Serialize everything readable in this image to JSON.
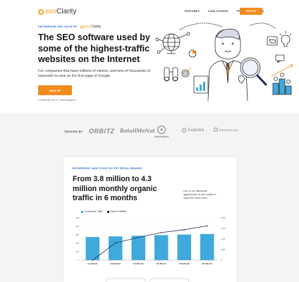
{
  "nav": {
    "logo_prefix": "seo",
    "logo_suffix": "Clarity",
    "links": [
      "FEATURES",
      "CASE STUDIES",
      "PRICING",
      "FAQS"
    ],
    "cta": "SIGN UP"
  },
  "hero": {
    "eyebrow": "ENTERPRISE SEO SUITE BY",
    "eyebrow_logo_prefix": "seo",
    "eyebrow_logo_suffix": "Clarity",
    "title": "The SEO software used by some of the highest-traffic websites on the Internet",
    "subtitle": "For companies that have millions of visitors, and tens of thousands of keywords to rank on the first page of Google.",
    "cta": "SIGN UP",
    "note": "*1 month per 30-75 + annual payment"
  },
  "trusted": {
    "label": "TRUSTED BY",
    "brands": [
      "ORBITZ",
      "RetailMeNot",
      "Autotrader",
      "Expedia",
      "overstock.com"
    ]
  },
  "case_study": {
    "eyebrow": "ENTERPRISE CASE STUDY BY PET RETAIL BRANDS",
    "title": "From 3.8 million to 4.3 million monthly organic traffic in 6 months",
    "note": "Due to our disclosure agreements we are unable to share the client name",
    "legend": [
      "Conversion Traffic",
      "Search Visibility"
    ]
  },
  "colors": {
    "accent": "#f08c1e",
    "brand_blue": "#1b5fc4",
    "bar": "#3fa9db",
    "line": "#1f2d5b"
  },
  "chart_data": {
    "type": "bar",
    "categories": [
      "1st Month",
      "2nd Month",
      "3rd Month",
      "4th Month",
      "5th Month",
      "6th Month"
    ],
    "series": [
      {
        "name": "Conversion Traffic",
        "type": "bar",
        "values": [
          3.8,
          3.9,
          4.0,
          4.1,
          4.2,
          4.3
        ]
      },
      {
        "name": "Search Visibility",
        "type": "line",
        "values": [
          0.0,
          0.9,
          1.2,
          1.45,
          1.6,
          1.8
        ]
      }
    ],
    "ylim_left": [
      0,
      5
    ],
    "ylim_right": [
      0,
      2
    ],
    "left_ticks": [
      "5M",
      "4M",
      "3M",
      "2M",
      "1M",
      "0"
    ],
    "right_ticks": [
      "2.0%",
      "1.5%",
      "1.0%",
      "0.5%",
      "0"
    ],
    "grid": true,
    "legend_position": "top-left"
  }
}
